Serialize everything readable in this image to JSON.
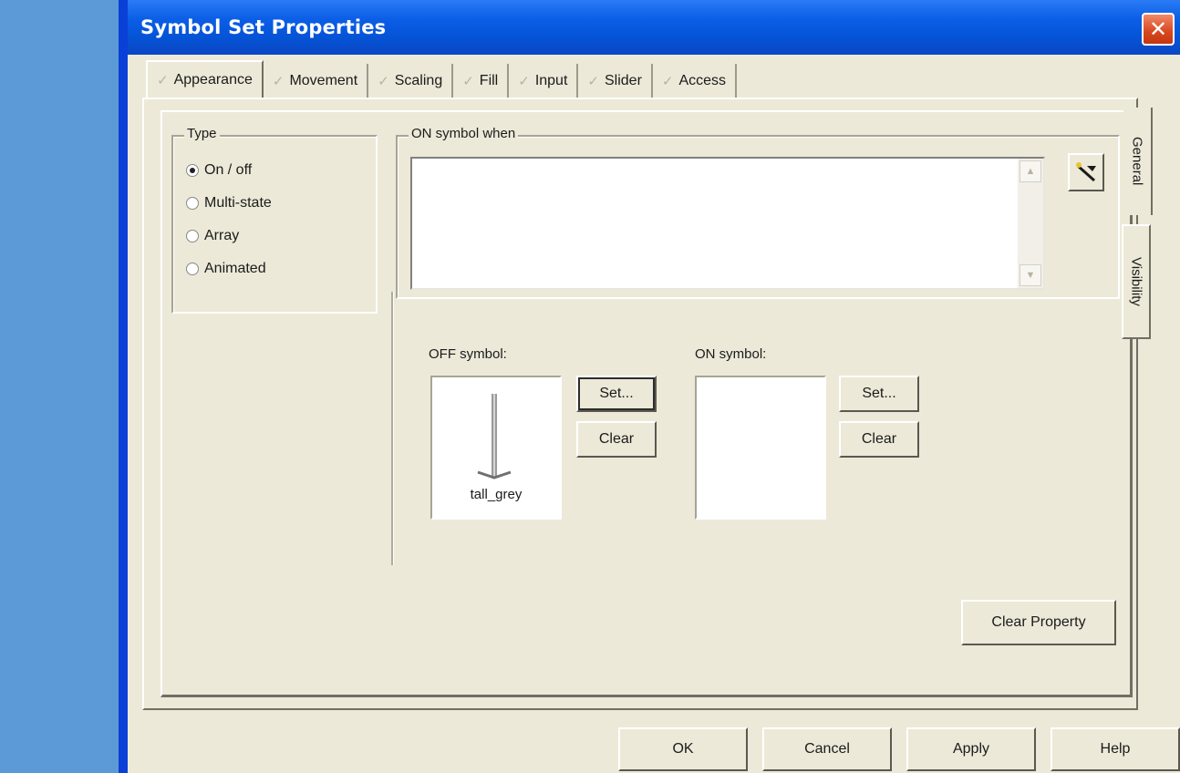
{
  "window": {
    "title": "Symbol Set Properties",
    "close_glyph": "✕"
  },
  "tabs": [
    {
      "label": "Appearance",
      "active": true
    },
    {
      "label": "Movement",
      "active": false
    },
    {
      "label": "Scaling",
      "active": false
    },
    {
      "label": "Fill",
      "active": false
    },
    {
      "label": "Input",
      "active": false
    },
    {
      "label": "Slider",
      "active": false
    },
    {
      "label": "Access",
      "active": false
    }
  ],
  "side_tabs": [
    {
      "label": "General"
    },
    {
      "label": "Visibility"
    }
  ],
  "type_group": {
    "label": "Type",
    "options": [
      {
        "label": "On / off",
        "checked": true
      },
      {
        "label": "Multi-state",
        "checked": false
      },
      {
        "label": "Array",
        "checked": false
      },
      {
        "label": "Animated",
        "checked": false
      }
    ]
  },
  "on_when": {
    "label": "ON symbol when",
    "value": ""
  },
  "off_symbol": {
    "label": "OFF symbol:",
    "caption": "tall_grey",
    "set_label": "Set...",
    "clear_label": "Clear"
  },
  "on_symbol": {
    "label": "ON symbol:",
    "caption": "",
    "set_label": "Set...",
    "clear_label": "Clear"
  },
  "clear_property_label": "Clear Property",
  "footer": {
    "ok_label": "OK",
    "cancel_label": "Cancel",
    "apply_label": "Apply",
    "help_label": "Help"
  },
  "colors": {
    "title_bar": "#0553d6",
    "dialog_bg": "#ece9d8",
    "desktop": "#5f9bd6"
  }
}
